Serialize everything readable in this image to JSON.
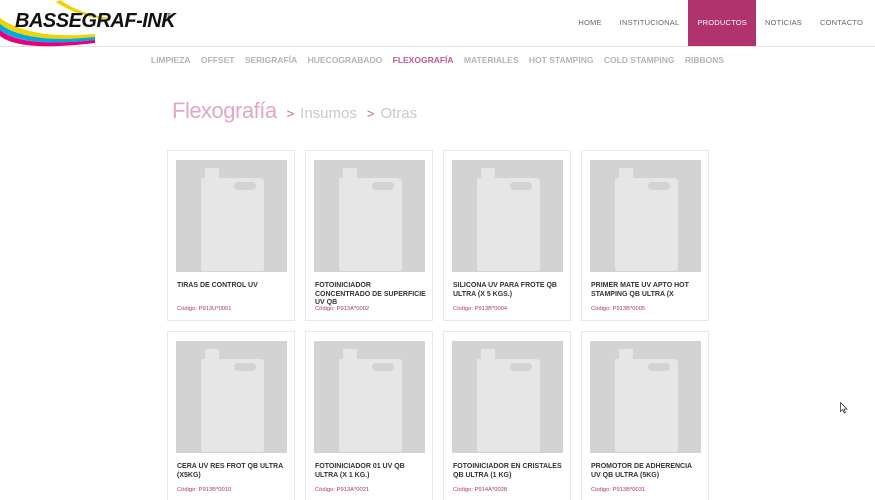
{
  "brand": {
    "name": "BASSEGRAF-INK",
    "reg_mark": "®"
  },
  "nav": [
    {
      "label": "HOME",
      "active": false
    },
    {
      "label": "INSTITUCIONAL",
      "active": false
    },
    {
      "label": "PRODUCTOS",
      "active": true
    },
    {
      "label": "NOTICIAS",
      "active": false
    },
    {
      "label": "CONTACTO",
      "active": false
    }
  ],
  "subnav": [
    {
      "label": "LIMPIEZA",
      "active": false
    },
    {
      "label": "OFFSET",
      "active": false
    },
    {
      "label": "SERIGRAFÍA",
      "active": false
    },
    {
      "label": "HUECOGRABADO",
      "active": false
    },
    {
      "label": "FLEXOGRAFÍA",
      "active": true
    },
    {
      "label": "MATERIALES",
      "active": false
    },
    {
      "label": "HOT STAMPING",
      "active": false
    },
    {
      "label": "COLD STAMPING",
      "active": false
    },
    {
      "label": "RIBBONS",
      "active": false
    }
  ],
  "breadcrumb": {
    "main": "Flexografía",
    "separator": ">",
    "level2": "Insumos",
    "level3": "Otras"
  },
  "products": [
    {
      "title": "TIRAS DE CONTROL UV",
      "code": "Código: P913U*0001"
    },
    {
      "title": "FOTOINICIADOR CONCENTRADO DE SUPERFICIE UV QB",
      "code": "Código: P913A*0002"
    },
    {
      "title": "SILICONA UV PARA FROTE QB ULTRA (X 5 KGS.)",
      "code": "Código: P913B*0004"
    },
    {
      "title": "PRIMER MATE UV APTO HOT STAMPING QB ULTRA (X",
      "code": "Código: P913B*0005"
    },
    {
      "title": "CERA UV RES FROT QB ULTRA (X5KG)",
      "code": "Código: P913B*0010"
    },
    {
      "title": "FOTOINICIADOR 01 UV QB ULTRA (X 1 KG.)",
      "code": "Código: P913A*0021"
    },
    {
      "title": "FOTOINICIADOR EN CRISTALES QB ULTRA (1 KG)",
      "code": "Código: P914A*0028"
    },
    {
      "title": "PROMOTOR DE ADHERENCIA UV QB ULTRA (5KG)",
      "code": "Código: P913B*0031"
    }
  ],
  "colors": {
    "accent": "#b0336e",
    "breadcrumb": "#e6a6c7",
    "thumb_bg": "#d3d3d3"
  }
}
